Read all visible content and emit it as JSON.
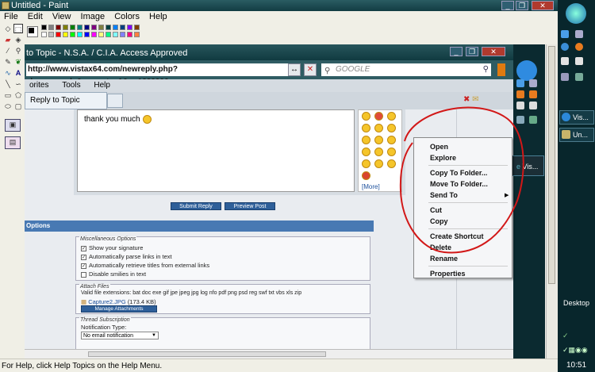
{
  "paint": {
    "title": "Untitled - Paint",
    "menu": [
      "File",
      "Edit",
      "View",
      "Image",
      "Colors",
      "Help"
    ],
    "status_text": "For Help, click Help Topics on the Help Menu.",
    "palette_colors": [
      "#000000",
      "#808080",
      "#800000",
      "#808000",
      "#008000",
      "#008080",
      "#000080",
      "#800080",
      "#808040",
      "#004040",
      "#0080ff",
      "#004080",
      "#8000ff",
      "#804000",
      "#ffffff",
      "#c0c0c0",
      "#ff0000",
      "#ffff00",
      "#00ff00",
      "#00ffff",
      "#0000ff",
      "#ff00ff",
      "#ffff80",
      "#00ff80",
      "#80ffff",
      "#8080ff",
      "#ff0080",
      "#ff8040"
    ]
  },
  "browser": {
    "title": "to Topic - N.S.A. / C.I.A. Access Approved",
    "address": "http://www.vistax64.com/newreply.php?do=newreply&noquote=1&p=1229996",
    "search_placeholder": "GOOGLE",
    "menu": [
      "orites",
      "Tools",
      "Help"
    ],
    "tab_label": "Reply to Topic",
    "editor_text": "thank you much",
    "more_link": "[More]",
    "submit_label": "Submit Reply",
    "preview_label": "Preview Post",
    "options_header": "Options",
    "misc_legend": "Miscellaneous Options",
    "misc_options": [
      {
        "label": "Show your signature",
        "checked": true
      },
      {
        "label": "Automatically parse links in text",
        "checked": true
      },
      {
        "label": "Automatically retrieve titles from external links",
        "checked": true
      },
      {
        "label": "Disable smilies in text",
        "checked": false
      }
    ],
    "attach_legend": "Attach Files",
    "attach_extensions": "Valid file extensions: bat doc exe gif jpe jpeg jpg log nfo pdf png psd reg swf txt vbs xls zip",
    "attach_file": "Capture2.JPG",
    "attach_size": "(173.4 KB)",
    "manage_label": "Manage Attachments",
    "thread_legend": "Thread Subscription",
    "notif_label": "Notification Type:",
    "notif_value": "No email notification"
  },
  "context_menu": {
    "items": [
      "Open",
      "Explore",
      "Copy To Folder...",
      "Move To Folder...",
      "Send To",
      "Cut",
      "Copy",
      "Create Shortcut",
      "Delete",
      "Rename",
      "Properties"
    ],
    "target_label": "Vis..."
  },
  "desktop": {
    "tasks": [
      "Vis...",
      "Un..."
    ],
    "label": "Desktop",
    "clock": "10:51"
  }
}
